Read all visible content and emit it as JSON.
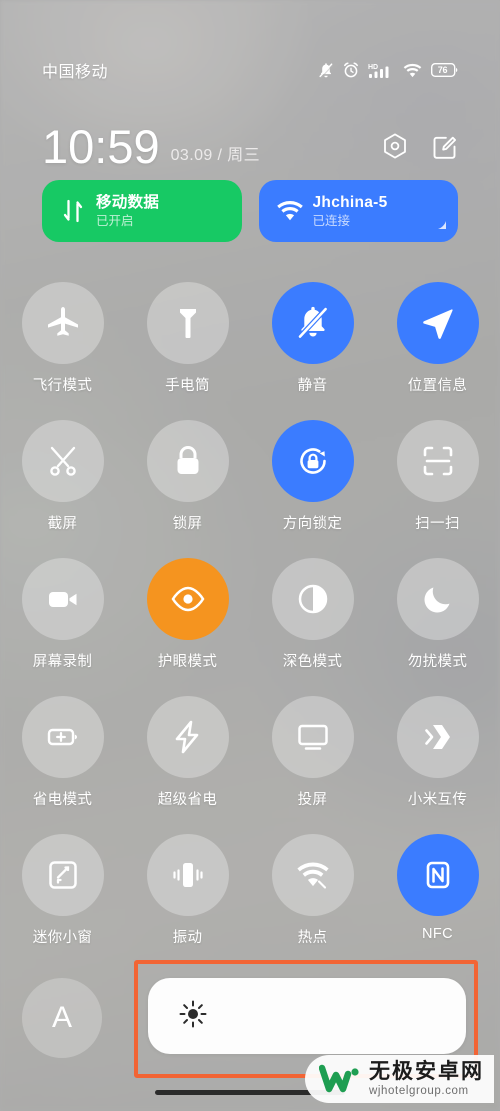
{
  "status_bar": {
    "carrier": "中国移动",
    "battery_level": "76",
    "icons": [
      "bell-muted-icon",
      "alarm-clock-icon",
      "hd-signal-icon",
      "wifi-icon",
      "battery-icon"
    ]
  },
  "header": {
    "time": "10:59",
    "date": "03.09 / 周三",
    "settings_label": "settings",
    "edit_label": "edit"
  },
  "connectivity_tiles": [
    {
      "title": "移动数据",
      "subtitle": "已开启",
      "state": "on",
      "color": "#17c964",
      "icon": "data-transfer-icon"
    },
    {
      "title": "Jhchina-5",
      "subtitle": "已连接",
      "state": "on",
      "color": "#3b7cff",
      "icon": "wifi-icon"
    }
  ],
  "toggles": [
    {
      "label": "飞行模式",
      "icon": "airplane-icon",
      "state": "off"
    },
    {
      "label": "手电筒",
      "icon": "flashlight-icon",
      "state": "off"
    },
    {
      "label": "静音",
      "icon": "bell-muted-icon",
      "state": "on"
    },
    {
      "label": "位置信息",
      "icon": "location-arrow-icon",
      "state": "on"
    },
    {
      "label": "截屏",
      "icon": "screenshot-icon",
      "state": "off"
    },
    {
      "label": "锁屏",
      "icon": "lock-icon",
      "state": "off"
    },
    {
      "label": "方向锁定",
      "icon": "rotation-lock-icon",
      "state": "on"
    },
    {
      "label": "扫一扫",
      "icon": "scan-icon",
      "state": "off"
    },
    {
      "label": "屏幕录制",
      "icon": "video-camera-icon",
      "state": "off"
    },
    {
      "label": "护眼模式",
      "icon": "eye-icon",
      "state": "on-orange"
    },
    {
      "label": "深色模式",
      "icon": "contrast-icon",
      "state": "off"
    },
    {
      "label": "勿扰模式",
      "icon": "moon-icon",
      "state": "off"
    },
    {
      "label": "省电模式",
      "icon": "battery-plus-icon",
      "state": "off"
    },
    {
      "label": "超级省电",
      "icon": "lightning-bolt-icon",
      "state": "off"
    },
    {
      "label": "投屏",
      "icon": "monitor-cast-icon",
      "state": "off"
    },
    {
      "label": "小米互传",
      "icon": "mi-share-icon",
      "state": "off"
    },
    {
      "label": "迷你小窗",
      "icon": "mini-window-icon",
      "state": "off"
    },
    {
      "label": "振动",
      "icon": "vibrate-icon",
      "state": "off"
    },
    {
      "label": "热点",
      "icon": "hotspot-icon",
      "state": "off"
    },
    {
      "label": "NFC",
      "icon": "nfc-icon",
      "state": "on"
    }
  ],
  "brightness": {
    "auto_label": "A",
    "slider_icon": "sun-icon",
    "value_percent": "100"
  },
  "highlight": {
    "color": "#f26434"
  },
  "watermark": {
    "name_cn": "无极安卓网",
    "site": "wjhotelgroup.com"
  },
  "colors": {
    "accent_blue": "#3b7cff",
    "accent_green": "#17c964",
    "accent_orange": "#f5941f",
    "highlight_orange": "#f26434"
  }
}
